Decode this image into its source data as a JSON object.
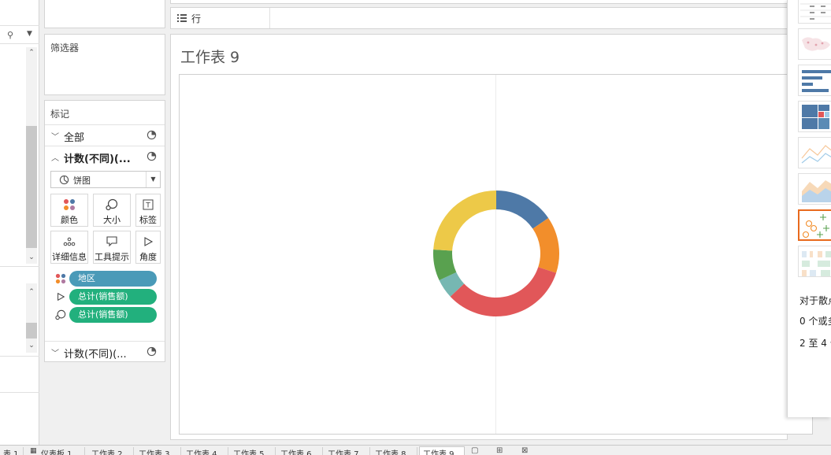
{
  "shelves": {
    "rows_label": "行"
  },
  "filters": {
    "title": "筛选器"
  },
  "marks": {
    "title": "标记",
    "all_label": "全部",
    "layer_label": "计数(不同)(...",
    "layer2_label": "计数(不同)(...",
    "mark_type": "饼图",
    "buttons": {
      "color": "颜色",
      "size": "大小",
      "label": "标签",
      "detail": "详细信息",
      "tooltip": "工具提示",
      "angle": "角度"
    },
    "pills": [
      {
        "text": "地区",
        "color": "#4a9ab8",
        "icon": "color-dots-icon"
      },
      {
        "text": "总计(销售额)",
        "color": "#22b07d",
        "icon": "angle-icon"
      },
      {
        "text": "总计(销售额)",
        "color": "#22b07d",
        "icon": "size-icon"
      }
    ]
  },
  "worksheet": {
    "title": "工作表 9"
  },
  "chart_data": {
    "type": "pie",
    "slices": [
      {
        "color": "#4e79a7",
        "value": 15.5
      },
      {
        "color": "#f28e2b",
        "value": 14.5
      },
      {
        "color": "#e15759",
        "value": 33
      },
      {
        "color": "#76b7b2",
        "value": 5
      },
      {
        "color": "#59a14f",
        "value": 8
      },
      {
        "color": "#edc948",
        "value": 24
      }
    ]
  },
  "show_me": {
    "lines": [
      "对于散点",
      "0 个或多",
      "2 至 4 个"
    ]
  },
  "tabs": [
    {
      "label": "表 1",
      "active": false
    },
    {
      "label": "仪表板 1",
      "active": false
    },
    {
      "label": "工作表 2",
      "active": false
    },
    {
      "label": "工作表 3",
      "active": false
    },
    {
      "label": "工作表 4",
      "active": false
    },
    {
      "label": "工作表 5",
      "active": false
    },
    {
      "label": "工作表 6",
      "active": false
    },
    {
      "label": "工作表 7",
      "active": false
    },
    {
      "label": "工作表 8",
      "active": false
    },
    {
      "label": "工作表 9",
      "active": true
    }
  ]
}
